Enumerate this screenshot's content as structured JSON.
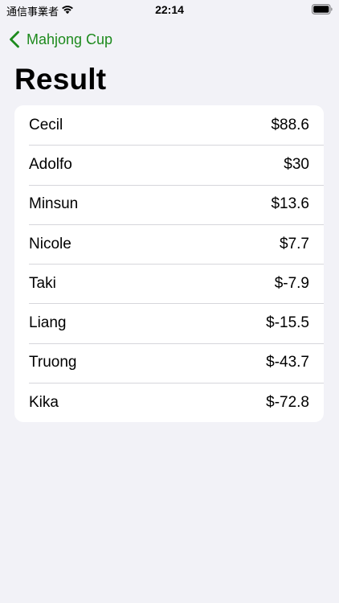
{
  "status_bar": {
    "carrier": "通信事業者",
    "time": "22:14",
    "wifi_icon": "wifi-icon",
    "battery_icon": "battery-icon"
  },
  "nav": {
    "back_label": "Mahjong Cup",
    "back_icon": "chevron-left-icon",
    "accent_color": "#1d8a1d"
  },
  "page": {
    "title": "Result"
  },
  "results": [
    {
      "name": "Cecil",
      "amount": "$88.6"
    },
    {
      "name": "Adolfo",
      "amount": "$30"
    },
    {
      "name": "Minsun",
      "amount": "$13.6"
    },
    {
      "name": "Nicole",
      "amount": "$7.7"
    },
    {
      "name": "Taki",
      "amount": "$-7.9"
    },
    {
      "name": "Liang",
      "amount": "$-15.5"
    },
    {
      "name": "Truong",
      "amount": "$-43.7"
    },
    {
      "name": "Kika",
      "amount": "$-72.8"
    }
  ]
}
